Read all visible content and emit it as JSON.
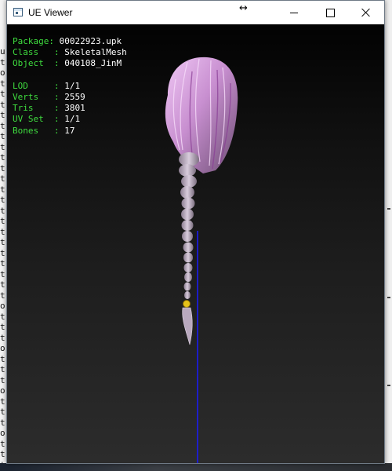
{
  "window": {
    "title": "UE Viewer",
    "icon": "app-window-icon",
    "controls": {
      "minimize_icon": "minimize-icon",
      "maximize_icon": "maximize-icon",
      "close_icon": "close-icon"
    },
    "cursor_glyph": "↔"
  },
  "background": {
    "console_glyphs": [
      "u",
      "t",
      "o",
      "t",
      "t",
      "t",
      "t",
      "t",
      "t",
      "t",
      "t",
      "t",
      "t",
      "t",
      "t",
      "t",
      "t",
      "t",
      "t",
      "t",
      "t",
      "t",
      "t",
      "t",
      "o",
      "t",
      "t",
      "t",
      "o",
      "t",
      "t",
      "t",
      "o",
      "t",
      "t",
      "t",
      "o",
      "t",
      "t",
      "t"
    ]
  },
  "info": {
    "rows_top": [
      {
        "label": "Package: ",
        "value": "00022923.upk"
      },
      {
        "label": "Class   : ",
        "value": "SkeletalMesh"
      },
      {
        "label": "Object  : ",
        "value": "040108_JinM"
      }
    ],
    "rows_bottom": [
      {
        "label": "LOD     : ",
        "value": "1/1"
      },
      {
        "label": "Verts   : ",
        "value": "2559"
      },
      {
        "label": "Tris    : ",
        "value": "3801"
      },
      {
        "label": "UV Set  : ",
        "value": "1/1"
      },
      {
        "label": "Bones   : ",
        "value": "17"
      }
    ]
  },
  "colors": {
    "label": "#3fdc3f",
    "value": "#ffffff",
    "hair_main": "#c88fd0",
    "hair_highlight": "#f0c8f5",
    "hair_shadow": "#7a5a80",
    "braid": "#b7a9bb",
    "bead": "#e6c21a",
    "axis": "#1a1aff"
  }
}
